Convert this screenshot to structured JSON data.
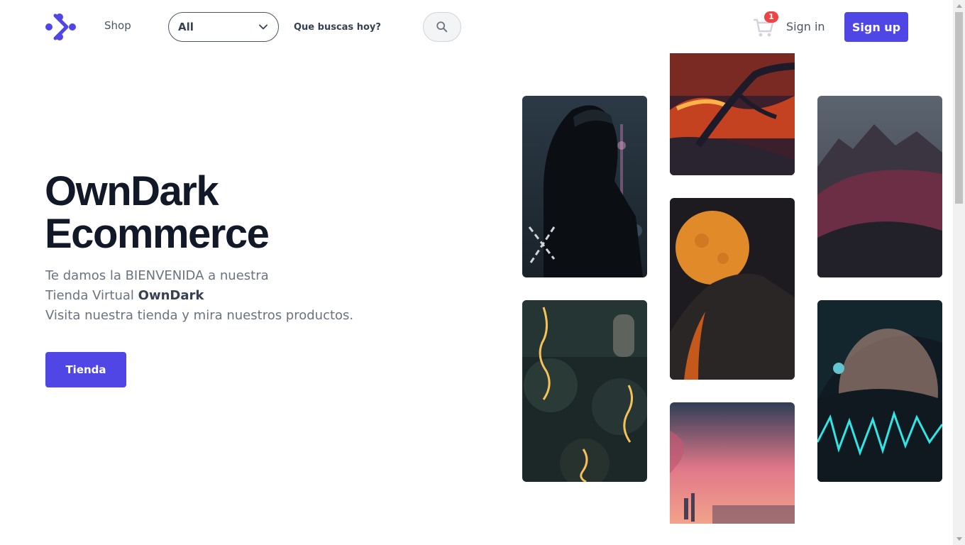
{
  "header": {
    "nav_shop": "Shop",
    "category_select": {
      "value": "All"
    },
    "search": {
      "placeholder": "Que buscas hoy?"
    },
    "cart": {
      "count": "1"
    },
    "signin_label": "Sign in",
    "signup_label": "Sign up"
  },
  "hero": {
    "title_line1": "OwnDark",
    "title_line2": "Ecommerce",
    "text_line1": "Te damos la BIENVENIDA a nuestra",
    "text_line2_prefix": "Tienda Virtual ",
    "text_line2_brand": "OwnDark",
    "text_line3": "Visita nuestra tienda y mira nuestros productos.",
    "cta_label": "Tienda"
  },
  "colors": {
    "accent": "#4f46e5",
    "badge": "#ef4444",
    "title": "#111827",
    "body_text": "#6b7280"
  },
  "icons": {
    "logo": "brand-logo-icon",
    "search": "search-icon",
    "cart": "cart-icon",
    "select": "chevron-down-icon"
  }
}
